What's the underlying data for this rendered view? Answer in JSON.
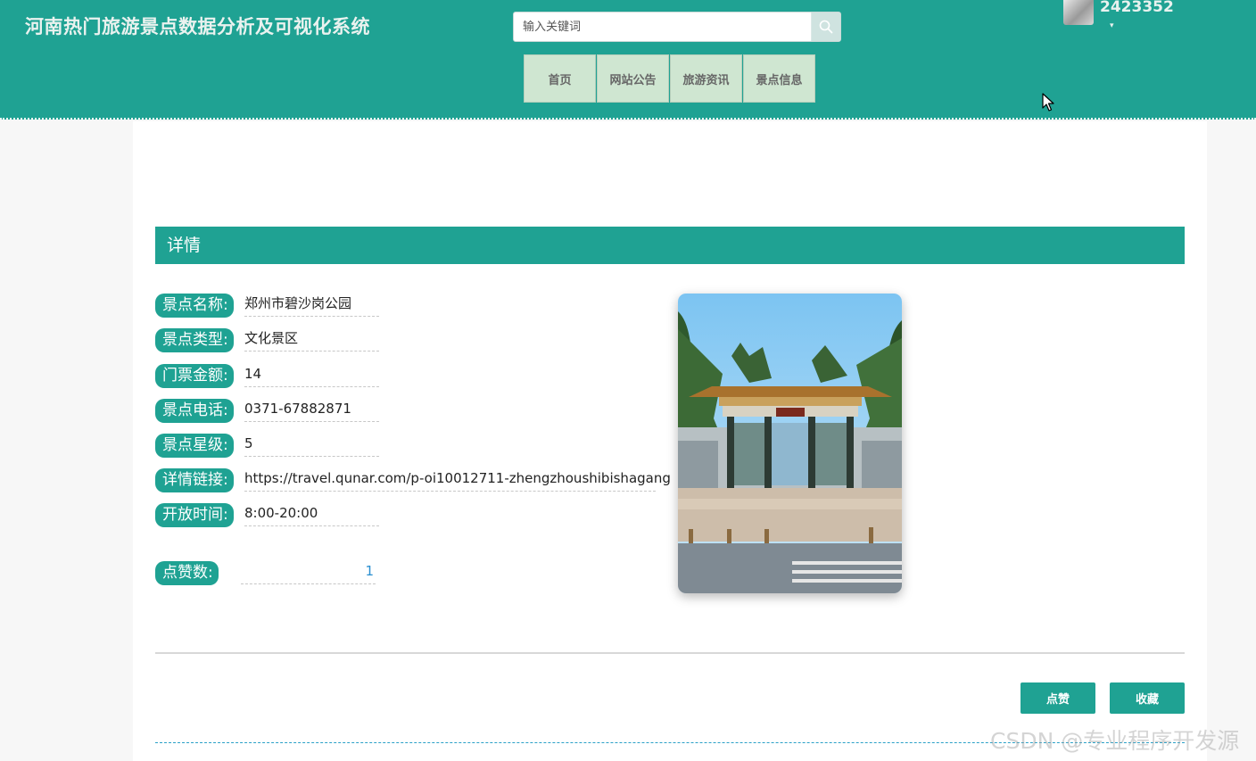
{
  "header": {
    "site_title": "河南热门旅游景点数据分析及可视化系统",
    "search_placeholder": "输入关键词",
    "nav": [
      {
        "label": "首页"
      },
      {
        "label": "网站公告"
      },
      {
        "label": "旅游资讯"
      },
      {
        "label": "景点信息"
      }
    ],
    "user": {
      "name": "2423352",
      "caret": "▾"
    }
  },
  "detail": {
    "section_title": "详情",
    "fields": [
      {
        "label": "景点名称:",
        "value": "郑州市碧沙岗公园"
      },
      {
        "label": "景点类型:",
        "value": "文化景区"
      },
      {
        "label": "门票金额:",
        "value": "14"
      },
      {
        "label": "景点电话:",
        "value": "0371-67882871"
      },
      {
        "label": "景点星级:",
        "value": "5"
      },
      {
        "label": "详情链接:",
        "value": "https://travel.qunar.com/p-oi10012711-zhengzhoushibishagang"
      },
      {
        "label": "开放时间:",
        "value": "8:00-20:00"
      }
    ],
    "likes": {
      "label": "点赞数:",
      "value": "1"
    }
  },
  "actions": {
    "like": "点赞",
    "favorite": "收藏"
  },
  "watermark": "CSDN @专业程序开发源",
  "colors": {
    "accent": "#1fa293",
    "nav_bg": "#cfe6d1",
    "like_count": "#2a8fd0"
  }
}
